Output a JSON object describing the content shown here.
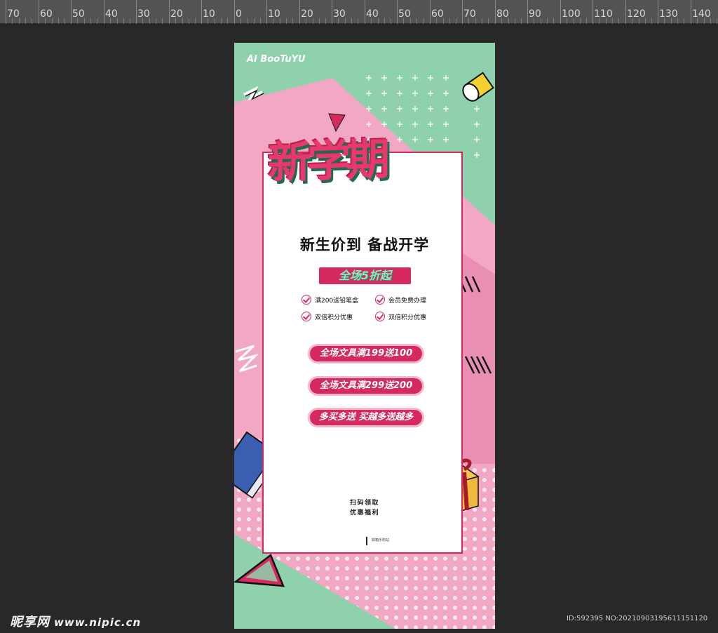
{
  "ruler": {
    "labels": [
      "70",
      "60",
      "50",
      "40",
      "30",
      "20",
      "10",
      "0",
      "10",
      "20",
      "30",
      "40",
      "50",
      "60",
      "70",
      "80",
      "90",
      "100",
      "110",
      "120",
      "130",
      "140"
    ]
  },
  "poster": {
    "brand": "AI BooTuYU",
    "headline": "新学期",
    "subtitle": "新生价到 备战开学",
    "discount_badge": "全场5折起",
    "features": [
      "满200送铅笔盒",
      "会员免费办理",
      "双倍积分优惠",
      "双倍积分优惠"
    ],
    "pills": [
      "全场文具满199送100",
      "全场文具满299送200",
      "多买多送 买越多送越多"
    ],
    "qr_text_line1": "扫码领取",
    "qr_text_line2": "优惠福利",
    "footer_text": "邮箱乐购站"
  },
  "watermark": {
    "site_name": "昵享网",
    "site_url": "www.nipic.cn",
    "image_id": "ID:592395 NO:20210903195611151120"
  },
  "colors": {
    "workspace_bg": "#282828",
    "ruler_bg": "#535353",
    "poster_mint": "#8fd0ad",
    "poster_pink": "#f2a8c4",
    "accent_red": "#d42a5f"
  }
}
